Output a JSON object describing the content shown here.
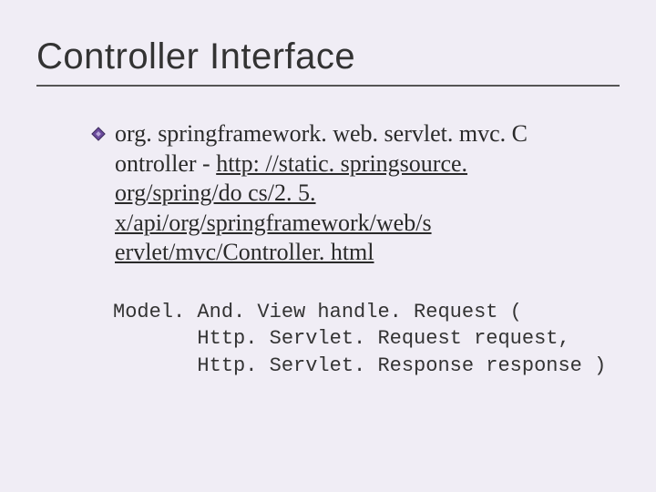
{
  "title": "Controller Interface",
  "bullet": {
    "prefix": "org. springframework. web. servlet. mvc. C ontroller - ",
    "link": "http: //static. springsource. org/spring/do cs/2. 5. x/api/org/springframework/web/s ervlet/mvc/Controller. html"
  },
  "code": "Model. And. View handle. Request (\n       Http. Servlet. Request request,\n       Http. Servlet. Response response )"
}
